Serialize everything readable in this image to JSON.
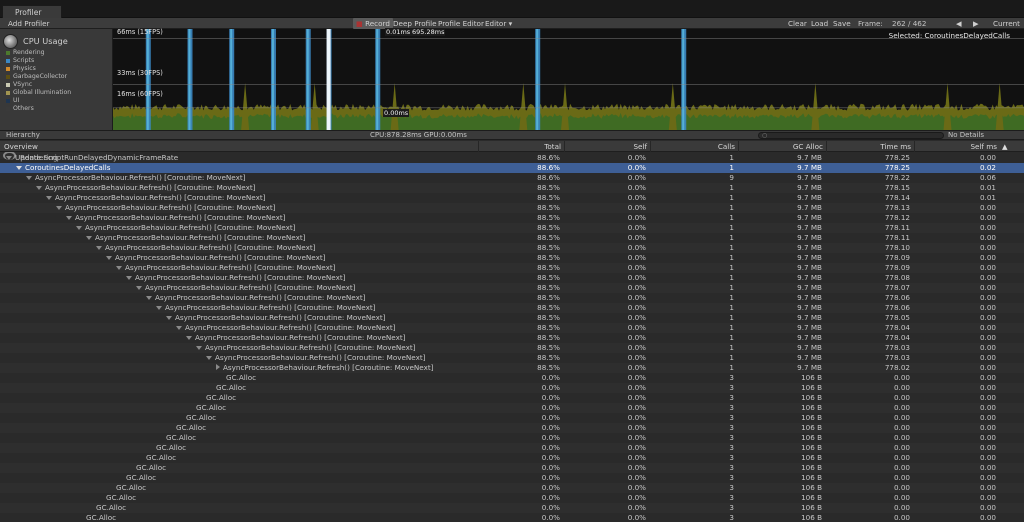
{
  "window": {
    "tab_title": "Profiler"
  },
  "toolbar": {
    "add_profiler": "Add Profiler",
    "record": "Record",
    "deep_profile": "Deep Profile",
    "profile_editor": "Profile Editor",
    "editor_dropdown": "Editor",
    "clear": "Clear",
    "load": "Load",
    "save": "Save",
    "frame_label": "Frame:",
    "frame_value": "262 / 462",
    "current": "Current"
  },
  "sidebar": {
    "module_title": "CPU Usage",
    "legend": [
      {
        "label": "Rendering",
        "color": "#4d7a2e"
      },
      {
        "label": "Scripts",
        "color": "#3b88c4"
      },
      {
        "label": "Physics",
        "color": "#d38b2a"
      },
      {
        "label": "GarbageCollector",
        "color": "#5b4e14"
      },
      {
        "label": "VSync",
        "color": "#c9c9b2"
      },
      {
        "label": "Global Illumination",
        "color": "#a19450"
      },
      {
        "label": "UI",
        "color": "#1f3550"
      },
      {
        "label": "Others",
        "color": "#3a3a3a"
      }
    ],
    "next_module": "Rendering"
  },
  "chart": {
    "axis_labels": [
      "66ms (15FPS)",
      "33ms (30FPS)",
      "16ms (60FPS)"
    ],
    "selected_label": "Selected: CoroutinesDelayedCalls",
    "cursor_top_left": "0.01ms",
    "cursor_top_right": "695.28ms",
    "cursor_bottom": "0.00ms",
    "colors": {
      "background": "#111111",
      "scripts": "#3b88c4",
      "gc": "#6a6a16",
      "rendering": "#3f6b23",
      "highlight": "#5cbbe0",
      "cursor": "#ffffff"
    }
  },
  "chart_data": {
    "type": "area",
    "title": "CPU Usage",
    "xlabel": "",
    "ylabel": "",
    "y_ticks": [
      "16ms (60FPS)",
      "33ms (30FPS)",
      "66ms (15FPS)"
    ],
    "ylim": [
      0,
      70
    ],
    "x_frame_range": [
      200,
      462
    ],
    "selected_frame": 262,
    "selected_total_ms": 695.28,
    "spike_series": {
      "name": "Scripts",
      "color": "#3b88c4"
    },
    "spike_frames": [
      210,
      222,
      234,
      246,
      256,
      262,
      276,
      322,
      364
    ],
    "baseline_ms": 14,
    "legend": [
      "Rendering",
      "Scripts",
      "Physics",
      "GarbageCollector",
      "VSync",
      "Global Illumination",
      "UI",
      "Others"
    ]
  },
  "status": {
    "view_mode": "Hierarchy",
    "cpu_gpu": "CPU:878.28ms   GPU:0.00ms",
    "no_details": "No Details"
  },
  "columns": {
    "overview": "Overview",
    "total": "Total",
    "self": "Self",
    "calls": "Calls",
    "gc_alloc": "GC Alloc",
    "time_ms": "Time ms",
    "self_ms": "Self ms"
  },
  "rows": [
    {
      "name": "Update.ScriptRunDelayedDynamicFrameRate",
      "indent": 0,
      "toggle": "open",
      "total": "88.6%",
      "self": "0.0%",
      "calls": "1",
      "gc": "9.7 MB",
      "time": "778.25",
      "selfms": "0.00"
    },
    {
      "name": "CoroutinesDelayedCalls",
      "indent": 1,
      "toggle": "open",
      "total": "88.6%",
      "self": "0.0%",
      "calls": "1",
      "gc": "9.7 MB",
      "time": "778.25",
      "selfms": "0.02",
      "selected": true
    },
    {
      "name": "AsyncProcessorBehaviour.Refresh() [Coroutine: MoveNext]",
      "indent": 2,
      "toggle": "open",
      "total": "88.6%",
      "self": "0.0%",
      "calls": "9",
      "gc": "9.7 MB",
      "time": "778.22",
      "selfms": "0.06"
    },
    {
      "name": "AsyncProcessorBehaviour.Refresh() [Coroutine: MoveNext]",
      "indent": 3,
      "toggle": "open",
      "total": "88.5%",
      "self": "0.0%",
      "calls": "1",
      "gc": "9.7 MB",
      "time": "778.15",
      "selfms": "0.01"
    },
    {
      "name": "AsyncProcessorBehaviour.Refresh() [Coroutine: MoveNext]",
      "indent": 4,
      "toggle": "open",
      "total": "88.5%",
      "self": "0.0%",
      "calls": "1",
      "gc": "9.7 MB",
      "time": "778.14",
      "selfms": "0.01"
    },
    {
      "name": "AsyncProcessorBehaviour.Refresh() [Coroutine: MoveNext]",
      "indent": 5,
      "toggle": "open",
      "total": "88.5%",
      "self": "0.0%",
      "calls": "1",
      "gc": "9.7 MB",
      "time": "778.13",
      "selfms": "0.00"
    },
    {
      "name": "AsyncProcessorBehaviour.Refresh() [Coroutine: MoveNext]",
      "indent": 6,
      "toggle": "open",
      "total": "88.5%",
      "self": "0.0%",
      "calls": "1",
      "gc": "9.7 MB",
      "time": "778.12",
      "selfms": "0.00"
    },
    {
      "name": "AsyncProcessorBehaviour.Refresh() [Coroutine: MoveNext]",
      "indent": 7,
      "toggle": "open",
      "total": "88.5%",
      "self": "0.0%",
      "calls": "1",
      "gc": "9.7 MB",
      "time": "778.11",
      "selfms": "0.00"
    },
    {
      "name": "AsyncProcessorBehaviour.Refresh() [Coroutine: MoveNext]",
      "indent": 8,
      "toggle": "open",
      "total": "88.5%",
      "self": "0.0%",
      "calls": "1",
      "gc": "9.7 MB",
      "time": "778.11",
      "selfms": "0.00"
    },
    {
      "name": "AsyncProcessorBehaviour.Refresh() [Coroutine: MoveNext]",
      "indent": 9,
      "toggle": "open",
      "total": "88.5%",
      "self": "0.0%",
      "calls": "1",
      "gc": "9.7 MB",
      "time": "778.10",
      "selfms": "0.00"
    },
    {
      "name": "AsyncProcessorBehaviour.Refresh() [Coroutine: MoveNext]",
      "indent": 10,
      "toggle": "open",
      "total": "88.5%",
      "self": "0.0%",
      "calls": "1",
      "gc": "9.7 MB",
      "time": "778.09",
      "selfms": "0.00"
    },
    {
      "name": "AsyncProcessorBehaviour.Refresh() [Coroutine: MoveNext]",
      "indent": 11,
      "toggle": "open",
      "total": "88.5%",
      "self": "0.0%",
      "calls": "1",
      "gc": "9.7 MB",
      "time": "778.09",
      "selfms": "0.00"
    },
    {
      "name": "AsyncProcessorBehaviour.Refresh() [Coroutine: MoveNext]",
      "indent": 12,
      "toggle": "open",
      "total": "88.5%",
      "self": "0.0%",
      "calls": "1",
      "gc": "9.7 MB",
      "time": "778.08",
      "selfms": "0.00"
    },
    {
      "name": "AsyncProcessorBehaviour.Refresh() [Coroutine: MoveNext]",
      "indent": 13,
      "toggle": "open",
      "total": "88.5%",
      "self": "0.0%",
      "calls": "1",
      "gc": "9.7 MB",
      "time": "778.07",
      "selfms": "0.00"
    },
    {
      "name": "AsyncProcessorBehaviour.Refresh() [Coroutine: MoveNext]",
      "indent": 14,
      "toggle": "open",
      "total": "88.5%",
      "self": "0.0%",
      "calls": "1",
      "gc": "9.7 MB",
      "time": "778.06",
      "selfms": "0.00"
    },
    {
      "name": "AsyncProcessorBehaviour.Refresh() [Coroutine: MoveNext]",
      "indent": 15,
      "toggle": "open",
      "total": "88.5%",
      "self": "0.0%",
      "calls": "1",
      "gc": "9.7 MB",
      "time": "778.06",
      "selfms": "0.00"
    },
    {
      "name": "AsyncProcessorBehaviour.Refresh() [Coroutine: MoveNext]",
      "indent": 16,
      "toggle": "open",
      "total": "88.5%",
      "self": "0.0%",
      "calls": "1",
      "gc": "9.7 MB",
      "time": "778.05",
      "selfms": "0.00"
    },
    {
      "name": "AsyncProcessorBehaviour.Refresh() [Coroutine: MoveNext]",
      "indent": 17,
      "toggle": "open",
      "total": "88.5%",
      "self": "0.0%",
      "calls": "1",
      "gc": "9.7 MB",
      "time": "778.04",
      "selfms": "0.00"
    },
    {
      "name": "AsyncProcessorBehaviour.Refresh() [Coroutine: MoveNext]",
      "indent": 18,
      "toggle": "open",
      "total": "88.5%",
      "self": "0.0%",
      "calls": "1",
      "gc": "9.7 MB",
      "time": "778.04",
      "selfms": "0.00"
    },
    {
      "name": "AsyncProcessorBehaviour.Refresh() [Coroutine: MoveNext]",
      "indent": 19,
      "toggle": "open",
      "total": "88.5%",
      "self": "0.0%",
      "calls": "1",
      "gc": "9.7 MB",
      "time": "778.03",
      "selfms": "0.00"
    },
    {
      "name": "AsyncProcessorBehaviour.Refresh() [Coroutine: MoveNext]",
      "indent": 20,
      "toggle": "open",
      "total": "88.5%",
      "self": "0.0%",
      "calls": "1",
      "gc": "9.7 MB",
      "time": "778.03",
      "selfms": "0.00"
    },
    {
      "name": "AsyncProcessorBehaviour.Refresh() [Coroutine: MoveNext]",
      "indent": 21,
      "toggle": "closed",
      "total": "88.5%",
      "self": "0.0%",
      "calls": "1",
      "gc": "9.7 MB",
      "time": "778.02",
      "selfms": "0.00"
    },
    {
      "name": "GC.Alloc",
      "indent": 22,
      "toggle": "none",
      "total": "0.0%",
      "self": "0.0%",
      "calls": "3",
      "gc": "106 B",
      "time": "0.00",
      "selfms": "0.00"
    },
    {
      "name": "GC.Alloc",
      "indent": 21,
      "toggle": "none",
      "total": "0.0%",
      "self": "0.0%",
      "calls": "3",
      "gc": "106 B",
      "time": "0.00",
      "selfms": "0.00"
    },
    {
      "name": "GC.Alloc",
      "indent": 20,
      "toggle": "none",
      "total": "0.0%",
      "self": "0.0%",
      "calls": "3",
      "gc": "106 B",
      "time": "0.00",
      "selfms": "0.00"
    },
    {
      "name": "GC.Alloc",
      "indent": 19,
      "toggle": "none",
      "total": "0.0%",
      "self": "0.0%",
      "calls": "3",
      "gc": "106 B",
      "time": "0.00",
      "selfms": "0.00"
    },
    {
      "name": "GC.Alloc",
      "indent": 18,
      "toggle": "none",
      "total": "0.0%",
      "self": "0.0%",
      "calls": "3",
      "gc": "106 B",
      "time": "0.00",
      "selfms": "0.00"
    },
    {
      "name": "GC.Alloc",
      "indent": 17,
      "toggle": "none",
      "total": "0.0%",
      "self": "0.0%",
      "calls": "3",
      "gc": "106 B",
      "time": "0.00",
      "selfms": "0.00"
    },
    {
      "name": "GC.Alloc",
      "indent": 16,
      "toggle": "none",
      "total": "0.0%",
      "self": "0.0%",
      "calls": "3",
      "gc": "106 B",
      "time": "0.00",
      "selfms": "0.00"
    },
    {
      "name": "GC.Alloc",
      "indent": 15,
      "toggle": "none",
      "total": "0.0%",
      "self": "0.0%",
      "calls": "3",
      "gc": "106 B",
      "time": "0.00",
      "selfms": "0.00"
    },
    {
      "name": "GC.Alloc",
      "indent": 14,
      "toggle": "none",
      "total": "0.0%",
      "self": "0.0%",
      "calls": "3",
      "gc": "106 B",
      "time": "0.00",
      "selfms": "0.00"
    },
    {
      "name": "GC.Alloc",
      "indent": 13,
      "toggle": "none",
      "total": "0.0%",
      "self": "0.0%",
      "calls": "3",
      "gc": "106 B",
      "time": "0.00",
      "selfms": "0.00"
    },
    {
      "name": "GC.Alloc",
      "indent": 12,
      "toggle": "none",
      "total": "0.0%",
      "self": "0.0%",
      "calls": "3",
      "gc": "106 B",
      "time": "0.00",
      "selfms": "0.00"
    },
    {
      "name": "GC.Alloc",
      "indent": 11,
      "toggle": "none",
      "total": "0.0%",
      "self": "0.0%",
      "calls": "3",
      "gc": "106 B",
      "time": "0.00",
      "selfms": "0.00"
    },
    {
      "name": "GC.Alloc",
      "indent": 10,
      "toggle": "none",
      "total": "0.0%",
      "self": "0.0%",
      "calls": "3",
      "gc": "106 B",
      "time": "0.00",
      "selfms": "0.00"
    },
    {
      "name": "GC.Alloc",
      "indent": 9,
      "toggle": "none",
      "total": "0.0%",
      "self": "0.0%",
      "calls": "3",
      "gc": "106 B",
      "time": "0.00",
      "selfms": "0.00"
    },
    {
      "name": "GC.Alloc",
      "indent": 8,
      "toggle": "none",
      "total": "0.0%",
      "self": "0.0%",
      "calls": "3",
      "gc": "106 B",
      "time": "0.00",
      "selfms": "0.00"
    },
    {
      "name": "GC.Alloc",
      "indent": 7,
      "toggle": "none",
      "total": "0.0%",
      "self": "0.0%",
      "calls": "3",
      "gc": "106 B",
      "time": "0.00",
      "selfms": "0.00"
    }
  ]
}
